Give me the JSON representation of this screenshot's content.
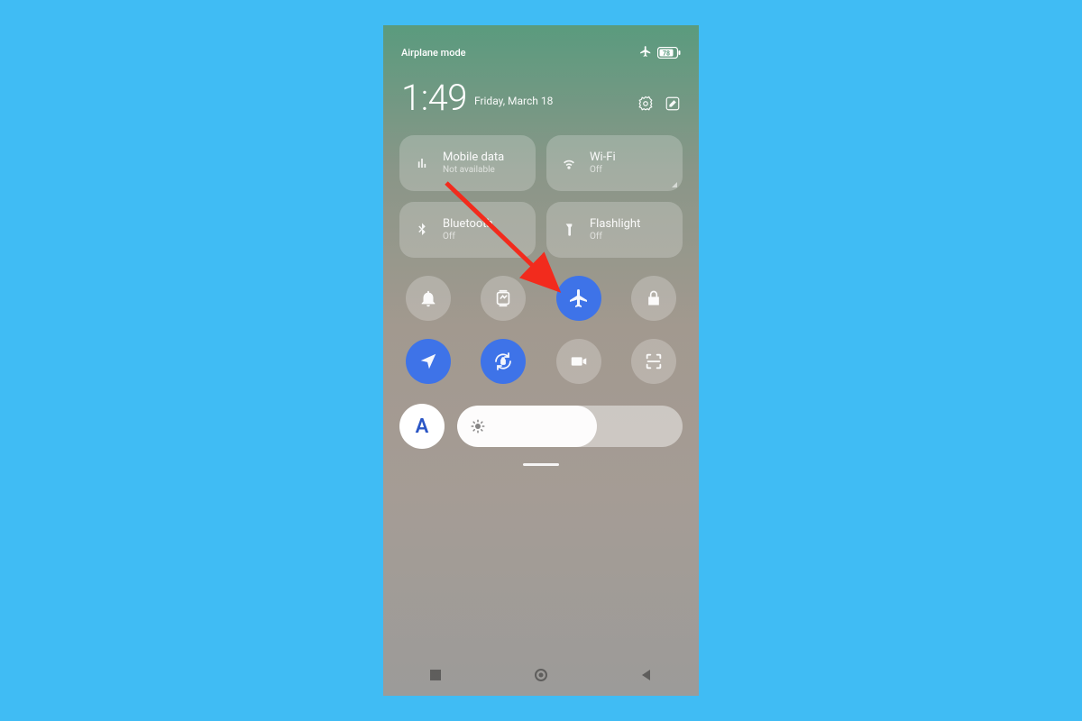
{
  "statusbar": {
    "label": "Airplane mode",
    "battery_percent": "78"
  },
  "header": {
    "time": "1:49",
    "date": "Friday, March 18"
  },
  "tiles": {
    "mobile_data": {
      "title": "Mobile data",
      "sub": "Not available"
    },
    "wifi": {
      "title": "Wi-Fi",
      "sub": "Off"
    },
    "bluetooth": {
      "title": "Bluetooth",
      "sub": "Off"
    },
    "flashlight": {
      "title": "Flashlight",
      "sub": "Off"
    }
  },
  "toggles": {
    "notifications_active": false,
    "screenshot_active": false,
    "airplane_active": true,
    "lock_active": false,
    "location_active": true,
    "autorotate_active": true,
    "screenrecord_active": false,
    "scanner_active": false
  },
  "brightness": {
    "auto_label": "A",
    "level_percent": 62
  },
  "colors": {
    "active_blue": "#3e73e8",
    "annotation_red": "#f22b1d"
  }
}
